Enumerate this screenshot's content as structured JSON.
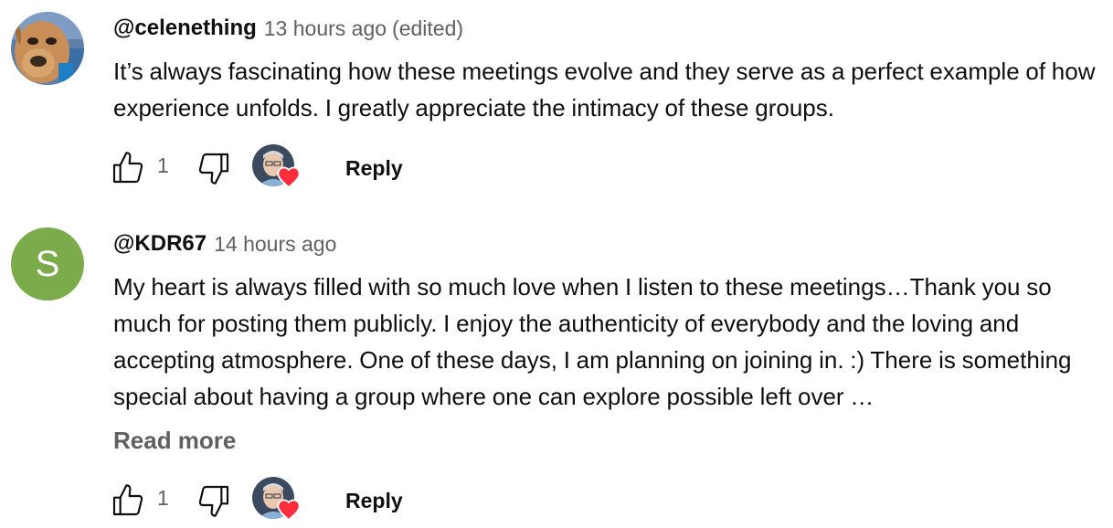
{
  "comments": [
    {
      "author": "@celenething",
      "time": "13 hours ago",
      "edited": "(edited)",
      "avatar_icon": "dog-photo-avatar",
      "text": "It’s always fascinating how these meetings evolve and they serve as a perfect example of how experience unfolds. I greatly appreciate the intimacy of these groups.",
      "like_count": "1",
      "reply_label": "Reply",
      "creator_heart": true
    },
    {
      "author": "@KDR67",
      "time": "14 hours ago",
      "avatar_letter": "S",
      "avatar_color": "#7cab4b",
      "text": "My heart is always filled with so much love when I listen to these meetings…Thank you so much for posting them publicly.  I enjoy the authenticity of everybody and the loving and accepting atmosphere. One of these days, I am planning on joining in. :) There is something special about having a group where one can explore possible left over …",
      "read_more": "Read more",
      "like_count": "1",
      "reply_label": "Reply",
      "creator_heart": true
    }
  ],
  "colors": {
    "text_primary": "#0f0f0f",
    "text_secondary": "#606060",
    "heart_red": "#ff2d3b"
  }
}
